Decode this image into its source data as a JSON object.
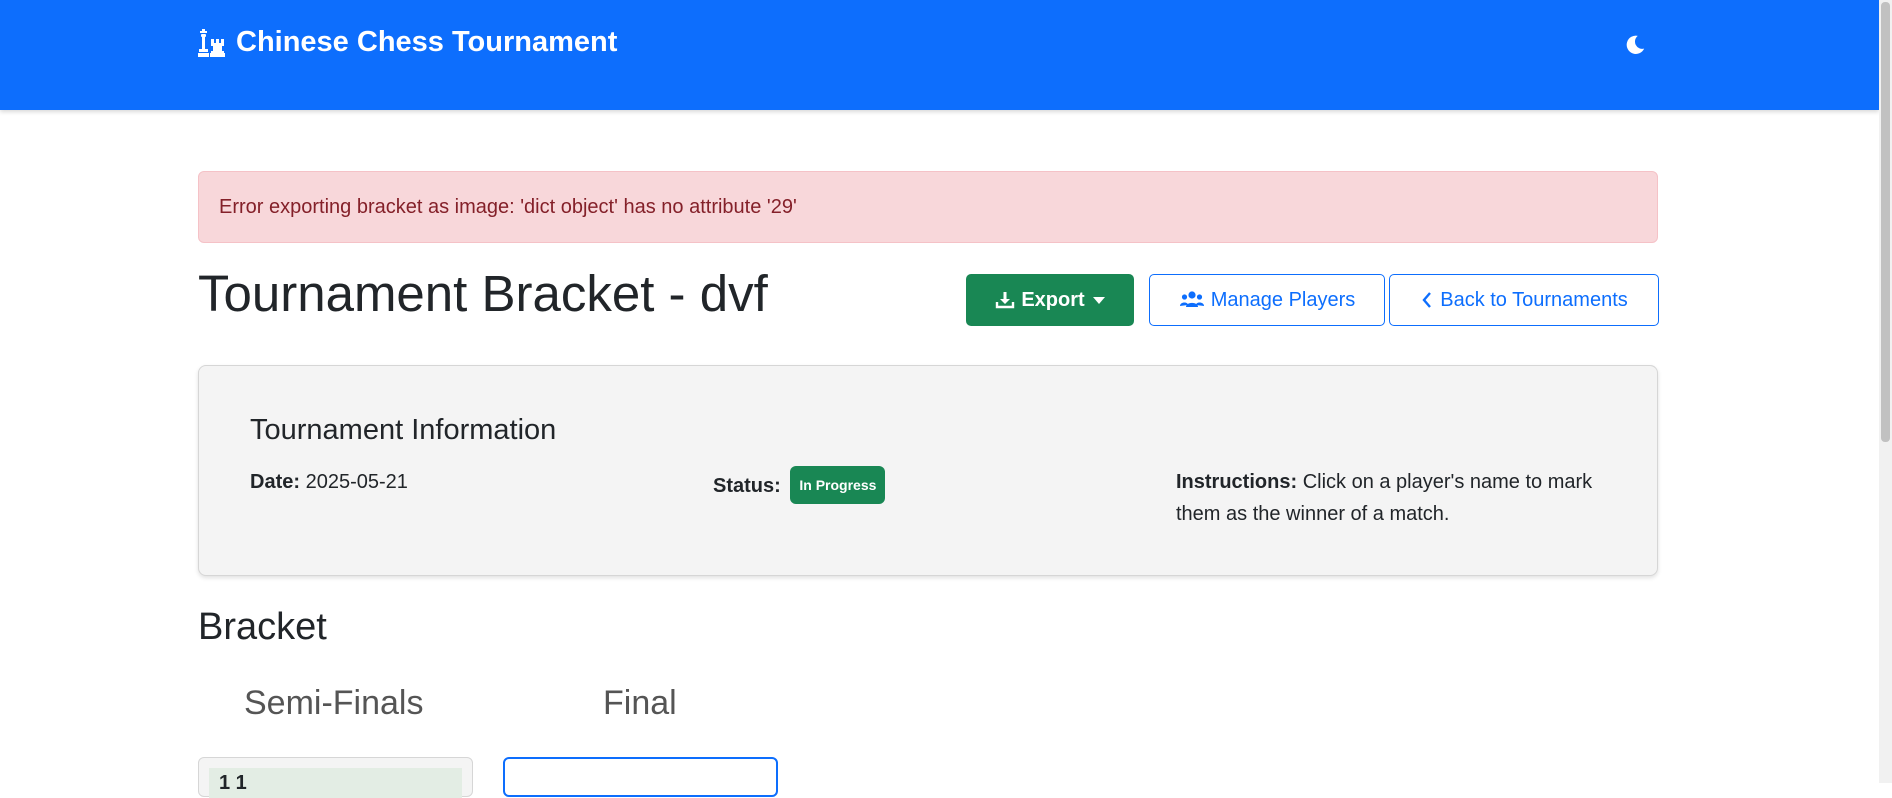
{
  "navbar": {
    "brand_title": "Chinese Chess Tournament",
    "brand_icon": "chess-pieces-icon",
    "theme_icon": "moon-icon"
  },
  "alert": {
    "message": "Error exporting bracket as image: 'dict object' has no attribute '29'"
  },
  "page": {
    "title": "Tournament Bracket - dvf"
  },
  "toolbar": {
    "export_label": "Export",
    "manage_players_label": "Manage Players",
    "back_label": "Back to Tournaments"
  },
  "tournament_info": {
    "heading": "Tournament Information",
    "date_label": "Date:",
    "date_value": "2025-05-21",
    "status_label": "Status:",
    "status_value": "In Progress",
    "instructions_label": "Instructions:",
    "instructions_text": "Click on a player's name to mark them as the winner of a match."
  },
  "bracket": {
    "heading": "Bracket",
    "rounds": [
      {
        "name": "Semi-Finals"
      },
      {
        "name": "Final"
      }
    ],
    "first_match_player": "1 1"
  },
  "colors": {
    "primary": "#0d6efd",
    "success": "#198754",
    "danger_bg": "#f8d7da",
    "danger_text": "#842029"
  }
}
